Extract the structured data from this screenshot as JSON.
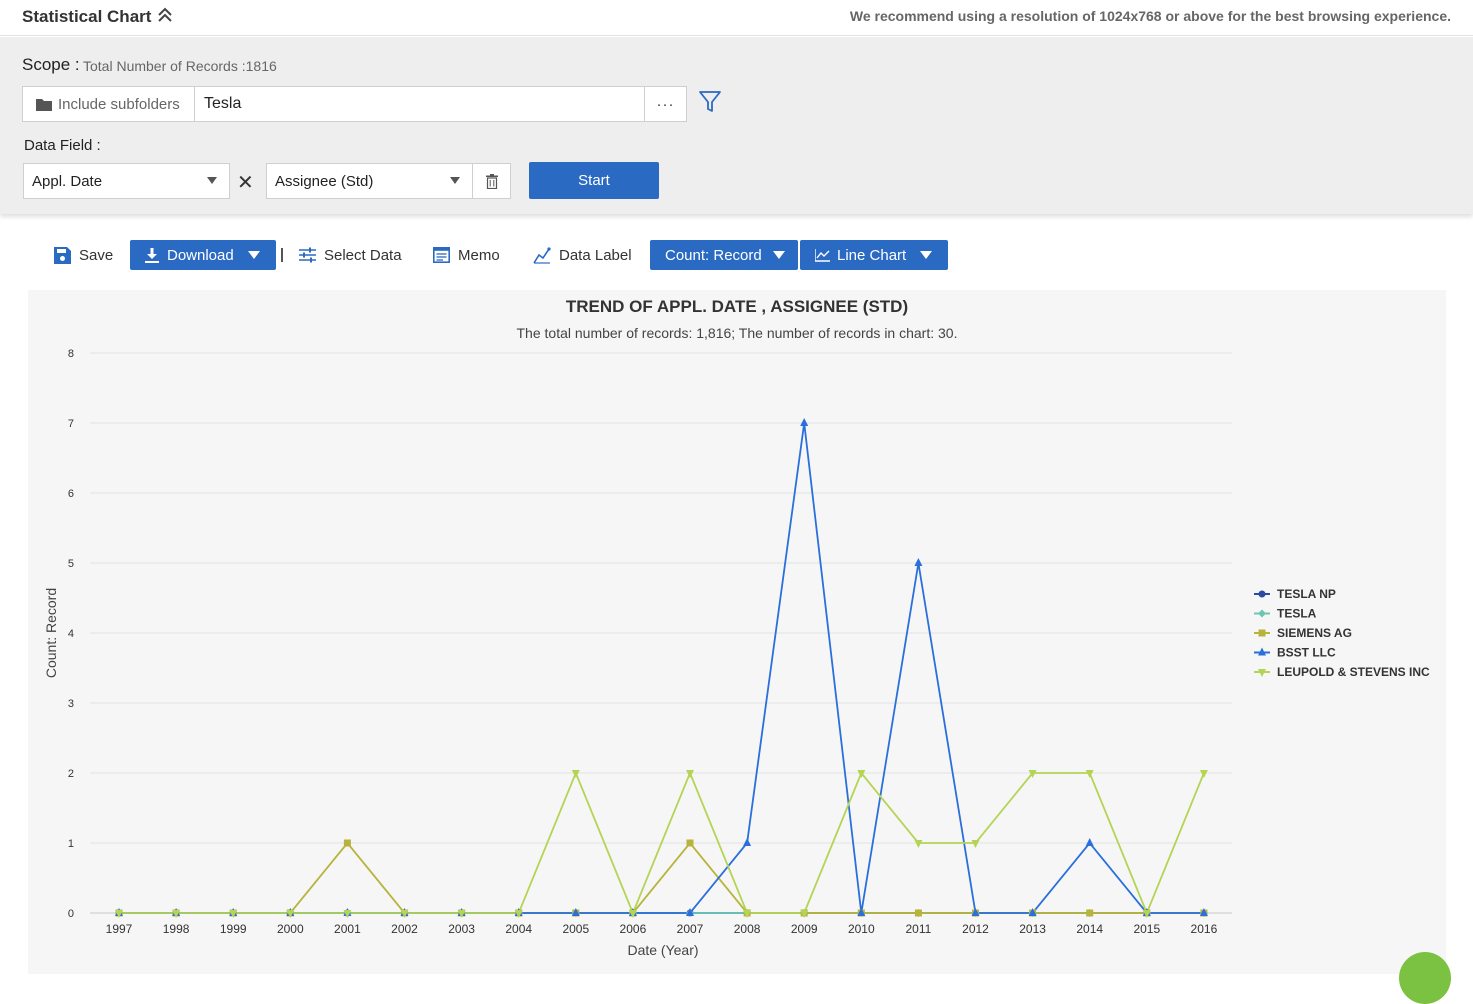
{
  "header": {
    "title": "Statistical Chart",
    "recommend": "We recommend using a resolution of 1024x768 or above for the best browsing experience."
  },
  "scope": {
    "label": "Scope :",
    "count_text": "Total Number of Records :1816",
    "subfolders_label": "Include subfolders",
    "value": "Tesla",
    "more": "···"
  },
  "data_field": {
    "label": "Data Field :",
    "field1": "Appl. Date",
    "field2": "Assignee (Std)",
    "remove": "✕",
    "start_label": "Start"
  },
  "toolbar": {
    "save": "Save",
    "download": "Download",
    "select_data": "Select Data",
    "memo": "Memo",
    "data_label": "Data Label",
    "count": "Count: Record",
    "chart_type": "Line Chart"
  },
  "colors": {
    "accent": "#2b6ac2",
    "fab": "#7cc242"
  },
  "chart_data": {
    "type": "line",
    "title": "TREND OF APPL. DATE , ASSIGNEE (STD)",
    "subtitle": "The total number of records: 1,816; The number of records in chart: 30.",
    "xlabel": "Date (Year)",
    "ylabel": "Count: Record",
    "ylim": [
      0,
      8
    ],
    "yticks": [
      "0",
      "1",
      "2",
      "3",
      "4",
      "5",
      "6",
      "7",
      "8"
    ],
    "categories": [
      "1997",
      "1998",
      "1999",
      "2000",
      "2001",
      "2002",
      "2003",
      "2004",
      "2005",
      "2006",
      "2007",
      "2008",
      "2009",
      "2010",
      "2011",
      "2012",
      "2013",
      "2014",
      "2015",
      "2016"
    ],
    "grid": "horizontal",
    "legend_position": "right",
    "series": [
      {
        "name": "TESLA NP",
        "color": "#2e4a9e",
        "marker": "circle",
        "values": [
          0,
          0,
          0,
          0,
          0,
          0,
          0,
          0,
          0,
          0,
          0,
          0,
          0,
          0,
          0,
          0,
          0,
          0,
          0,
          0
        ]
      },
      {
        "name": "TESLA",
        "color": "#6cc6b4",
        "marker": "diamond",
        "values": [
          0,
          0,
          0,
          0,
          0,
          0,
          0,
          0,
          0,
          0,
          0,
          0,
          0,
          0,
          0,
          0,
          0,
          0,
          0,
          0
        ]
      },
      {
        "name": "SIEMENS AG",
        "color": "#b8b33a",
        "marker": "square",
        "values": [
          0,
          0,
          0,
          0,
          1,
          0,
          0,
          0,
          0,
          0,
          1,
          0,
          0,
          0,
          0,
          0,
          0,
          0,
          0,
          0
        ]
      },
      {
        "name": "BSST LLC",
        "color": "#2a6fdb",
        "marker": "triangle",
        "values": [
          0,
          0,
          0,
          0,
          0,
          0,
          0,
          0,
          0,
          0,
          0,
          1,
          7,
          0,
          5,
          0,
          0,
          1,
          0,
          0
        ]
      },
      {
        "name": "LEUPOLD & STEVENS INC",
        "color": "#b4d455",
        "marker": "triangle-down",
        "values": [
          0,
          0,
          0,
          0,
          0,
          0,
          0,
          0,
          2,
          0,
          2,
          0,
          0,
          2,
          1,
          1,
          2,
          2,
          0,
          2
        ]
      }
    ]
  }
}
